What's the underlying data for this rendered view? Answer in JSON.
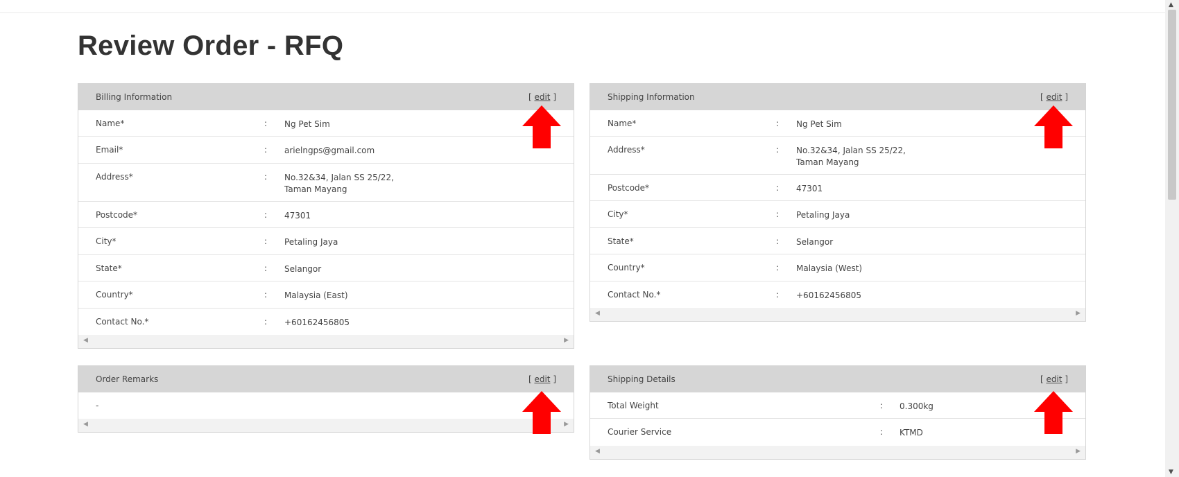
{
  "page": {
    "title": "Review Order - RFQ"
  },
  "edit_label": "edit",
  "billing": {
    "title": "Billing Information",
    "rows": [
      {
        "label": "Name*",
        "value": "Ng Pet Sim"
      },
      {
        "label": "Email*",
        "value": "arielngps@gmail.com"
      },
      {
        "label": "Address*",
        "value": "No.32&34, Jalan SS 25/22,",
        "value2": "Taman Mayang"
      },
      {
        "label": "Postcode*",
        "value": "47301"
      },
      {
        "label": "City*",
        "value": "Petaling Jaya"
      },
      {
        "label": "State*",
        "value": "Selangor"
      },
      {
        "label": "Country*",
        "value": "Malaysia (East)"
      },
      {
        "label": "Contact No.*",
        "value": "+60162456805"
      }
    ]
  },
  "shipping": {
    "title": "Shipping Information",
    "rows": [
      {
        "label": "Name*",
        "value": "Ng Pet Sim"
      },
      {
        "label": "Address*",
        "value": "No.32&34, Jalan SS 25/22,",
        "value2": "Taman Mayang"
      },
      {
        "label": "Postcode*",
        "value": "47301"
      },
      {
        "label": "City*",
        "value": "Petaling Jaya"
      },
      {
        "label": "State*",
        "value": "Selangor"
      },
      {
        "label": "Country*",
        "value": "Malaysia (West)"
      },
      {
        "label": "Contact No.*",
        "value": "+60162456805"
      }
    ]
  },
  "remarks": {
    "title": "Order Remarks",
    "value": "-"
  },
  "shipping_details": {
    "title": "Shipping Details",
    "rows": [
      {
        "label": "Total Weight",
        "value": "0.300kg"
      },
      {
        "label": "Courier Service",
        "value": "KTMD"
      }
    ]
  },
  "separator": ":",
  "colors": {
    "header_bg": "#d6d6d6",
    "arrow": "#ff0000",
    "border": "#d4d4d4"
  }
}
